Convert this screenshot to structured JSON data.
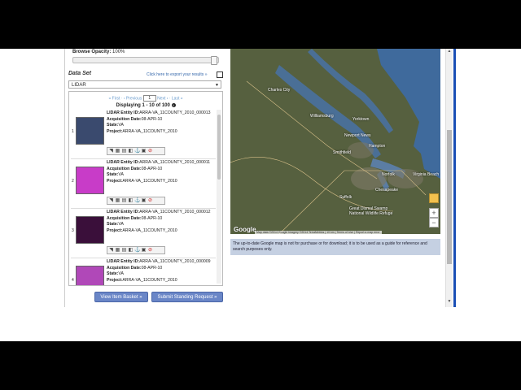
{
  "browse_opacity": {
    "label": "Browse Opacity:",
    "value": "100%",
    "level": 1.0
  },
  "data_set": {
    "title": "Data Set",
    "export_link": "Click here to export your results »",
    "selected": "LIDAR"
  },
  "pager": {
    "first": "« First",
    "previous": "‹ Previous",
    "page": "1",
    "next": "Next ›",
    "last": "Last »",
    "displaying": "Displaying 1 - 10 of 100"
  },
  "results": [
    {
      "num": "1",
      "entity_label": "LIDAR Entity ID:",
      "entity_id": "ARRA-VA_11COUNTY_2010_000013",
      "acq_label": "Acquisition Date:",
      "acq_date": "08-APR-10",
      "state_label": "State:",
      "state": "VA",
      "project_label": "Project:",
      "project": "ARRA-VA_11COUNTY_2010",
      "thumb_color": "#3a4a6e"
    },
    {
      "num": "2",
      "entity_label": "LIDAR Entity ID:",
      "entity_id": "ARRA-VA_11COUNTY_2010_000011",
      "acq_label": "Acquisition Date:",
      "acq_date": "08-APR-10",
      "state_label": "State:",
      "state": "VA",
      "project_label": "Project:",
      "project": "ARRA-VA_11COUNTY_2010",
      "thumb_color": "#c83cc8"
    },
    {
      "num": "3",
      "entity_label": "LIDAR Entity ID:",
      "entity_id": "ARRA-VA_11COUNTY_2010_000012",
      "acq_label": "Acquisition Date:",
      "acq_date": "08-APR-10",
      "state_label": "State:",
      "state": "VA",
      "project_label": "Project:",
      "project": "ARRA-VA_11COUNTY_2010",
      "thumb_color": "#3a0f3a"
    },
    {
      "num": "4",
      "entity_label": "LIDAR Entity ID:",
      "entity_id": "ARRA-VA_11COUNTY_2010_000009",
      "acq_label": "Acquisition Date:",
      "acq_date": "08-APR-10",
      "state_label": "State:",
      "state": "VA",
      "project_label": "Project:",
      "project": "ARRA-VA_11COUNTY_2010",
      "thumb_color": "#b048b8"
    }
  ],
  "buttons": {
    "view_basket": "View Item Basket »",
    "standing_request": "Submit Standing Request »"
  },
  "map": {
    "places": [
      "Charles City",
      "Williamsburg",
      "Newport News",
      "Hampton",
      "Norfolk",
      "Virginia Beach",
      "Chesapeake",
      "Suffolk",
      "Great Dismal Swamp National Wildlife Refuge",
      "Smithfield",
      "Yorktown"
    ],
    "google": "Google",
    "attribution": "Map data ©2014 Google Imagery ©2014 TerraMetrics | 10 km | Terms of Use | Report a map error",
    "disclaimer": "The up-to-date Google map is not for purchase or for download; it is to be used as a guide for reference and search purposes only.",
    "zoom_in": "+",
    "zoom_out": "−"
  },
  "colors": {
    "accent": "#6a86c7",
    "link": "#3366aa",
    "disclaimer_bg": "#c5d0e2"
  }
}
